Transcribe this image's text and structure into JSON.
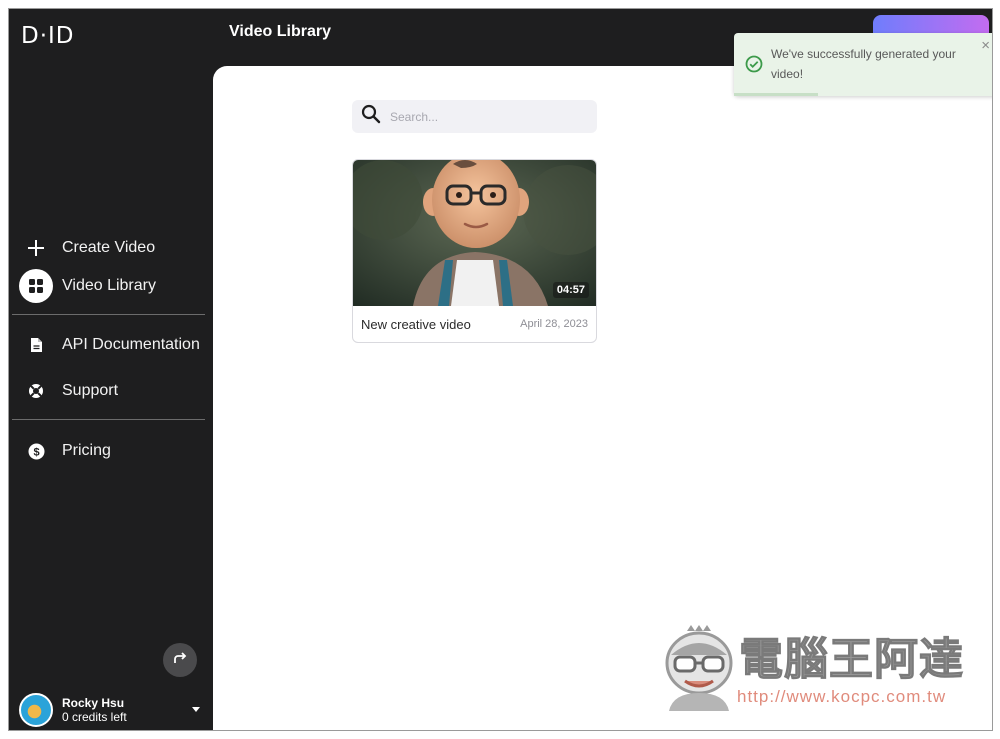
{
  "app": {
    "logo": "D·ID"
  },
  "header": {
    "title": "Video Library"
  },
  "sidebar": {
    "items": [
      {
        "label": "Create Video",
        "icon": "plus-icon"
      },
      {
        "label": "Video Library",
        "icon": "grid-icon",
        "active": true
      },
      {
        "label": "API Documentation",
        "icon": "document-icon"
      },
      {
        "label": "Support",
        "icon": "lifebuoy-icon"
      },
      {
        "label": "Pricing",
        "icon": "dollar-icon"
      }
    ],
    "collapse_icon": "share-arrow-icon"
  },
  "user": {
    "name": "Rocky Hsu",
    "credits": "0 credits left"
  },
  "search": {
    "placeholder": "Search..."
  },
  "videos": [
    {
      "title": "New creative video",
      "date": "April 28, 2023",
      "duration": "04:57"
    }
  ],
  "toast": {
    "message": "We've successfully generated your video!",
    "close": "×",
    "status": "success"
  },
  "watermark": {
    "text": "電腦王阿達",
    "url": "http://www.kocpc.com.tw"
  },
  "colors": {
    "sidebar_bg": "#1e1e1f",
    "toast_bg": "#e9f3e8",
    "toast_icon": "#3c9a4a",
    "accent_gradient_start": "#6f7dfc",
    "accent_gradient_end": "#c36cf0"
  }
}
